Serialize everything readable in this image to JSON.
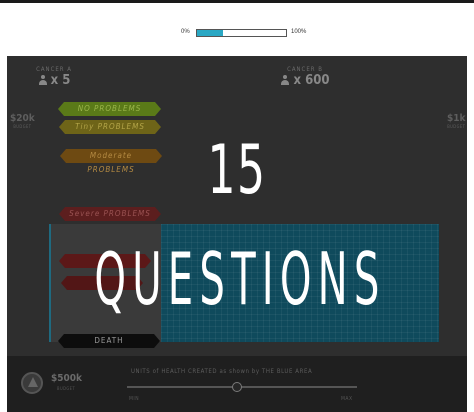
{
  "progress": {
    "min_label": "0%",
    "max_label": "100%",
    "value": 0.29,
    "fill_color": "#2aa8c4"
  },
  "scenario": {
    "left_column": {
      "title": "CANCER A",
      "people": "x 5"
    },
    "right_column": {
      "title": "CANCER B",
      "people": "x 600"
    },
    "left_cost": {
      "value": "$20k",
      "sub": "BUDGET"
    },
    "right_cost": {
      "value": "$1k",
      "sub": "BUDGET"
    },
    "severity_levels": [
      {
        "label": "NO PROBLEMS",
        "color": "#5a7a18"
      },
      {
        "label": "Tiny PROBLEMS",
        "color": "#6e6418"
      },
      {
        "label": "Moderate PROBLEMS",
        "color": "#6e4a12"
      },
      {
        "label": "Severe PROBLEMS",
        "color": "#5c1e1e"
      },
      {
        "label": "",
        "color": "#5c1818"
      },
      {
        "label": "",
        "color": "#521616"
      },
      {
        "label": "DEATH",
        "color": "#0d0d0d"
      }
    ],
    "blue_area_color": "#0f4a5c"
  },
  "overlay": {
    "line1": "15",
    "line2": "QUESTIONS"
  },
  "bottom": {
    "budget": "$500k",
    "budget_sub": "BUDGET",
    "caption": "UNITS of HEALTH CREATED as shown by THE BLUE AREA",
    "slider_value": 0.48,
    "min_label": "MIN",
    "max_label": "MAX"
  }
}
